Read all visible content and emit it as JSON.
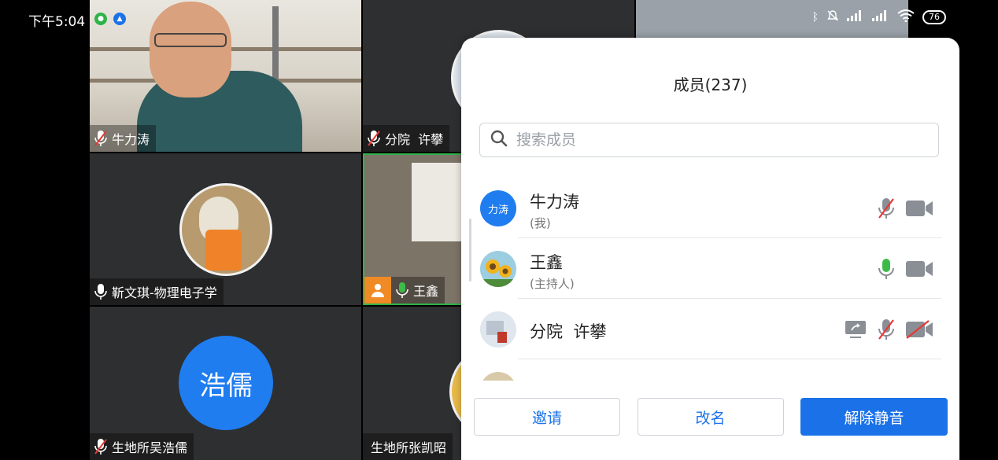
{
  "status": {
    "time": "下午5:04",
    "battery": "76"
  },
  "tiles": [
    {
      "name": "牛力涛"
    },
    {
      "name": "分院  许攀"
    },
    {
      "name": "靳文琪-物理电子学"
    },
    {
      "name": "王鑫"
    },
    {
      "name": "生地所吴浩儒",
      "initials": "浩儒"
    },
    {
      "name": "生地所张凯昭"
    }
  ],
  "panel": {
    "title": "成员(237)",
    "search_placeholder": "搜索成员",
    "members": [
      {
        "name": "牛力涛",
        "role": "(我)",
        "initials": "力涛",
        "mic": "muted",
        "camera": "on"
      },
      {
        "name": "王鑫",
        "role": "(主持人)",
        "mic": "active",
        "camera": "on"
      },
      {
        "name": "分院  许攀",
        "role": "",
        "mic": "muted",
        "camera": "off",
        "sharing": true
      }
    ],
    "buttons": {
      "invite": "邀请",
      "rename": "改名",
      "unmute_all": "解除静音"
    }
  },
  "colors": {
    "accent": "#1b72e8",
    "mic_active": "#3dbb48",
    "muted_slash": "#e53935",
    "icon_gray": "#8a8f96"
  }
}
